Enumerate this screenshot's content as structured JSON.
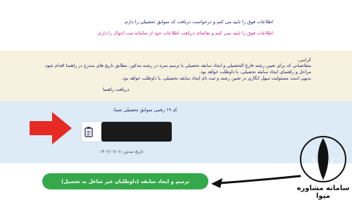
{
  "page": {
    "status_line_1": "اطلاعات فوق را تایید می کنم و درخواست دریافت کد سوابق تحصیلی را دارم.",
    "status_line_2": "اطلاعات فوق را تایید نمی کنم و تقاضای دریافت اطلاعات خود از سامانه ثبت احوال را دارم."
  },
  "info_panel": {
    "title": "کرامی،",
    "line_1": "متقاضیانی که برای تعیین رشته فارغ التحصیلی و ایجاد سابقه تحصیلی یا ترمیم نمره در رشته مذکور، مطابق تاریخ های مندرج در راهنما اقدام شود.",
    "line_2": "مراحل و راهنمای ایجاد سابقه تحصیلی، با داوطلب خواهد بود.",
    "line_3": "بدیهی است مسئولیت سهل انگاری در تعیین رشته و ثبت نام ایجاد سابقه تحصیلی، با داوطلب خواهد بود.",
    "guide_link": "دریافت راهنما"
  },
  "record_panel": {
    "code_title": "کد ۱۹ رقمی سوابق تحصیلی شما:",
    "issue_date": "تاریخ صدور: ۱۴۰۲/۰۲/۰۸"
  },
  "actions": {
    "primary_button": "ترمیم و ایجاد سابقه (داوطلبان غیر شاغل به تحصیل)"
  },
  "logo": {
    "text": "سامانه مشاوره میوا"
  },
  "colors": {
    "record_panel_bg": "#dcebf6",
    "info_panel_bg": "#f7f1df",
    "button_green": "#35a84b",
    "arrow_red": "#e52b24"
  },
  "icons": [
    "copy-icon",
    "red-arrow-icon",
    "black-arrow-icon",
    "logo-emblem"
  ]
}
